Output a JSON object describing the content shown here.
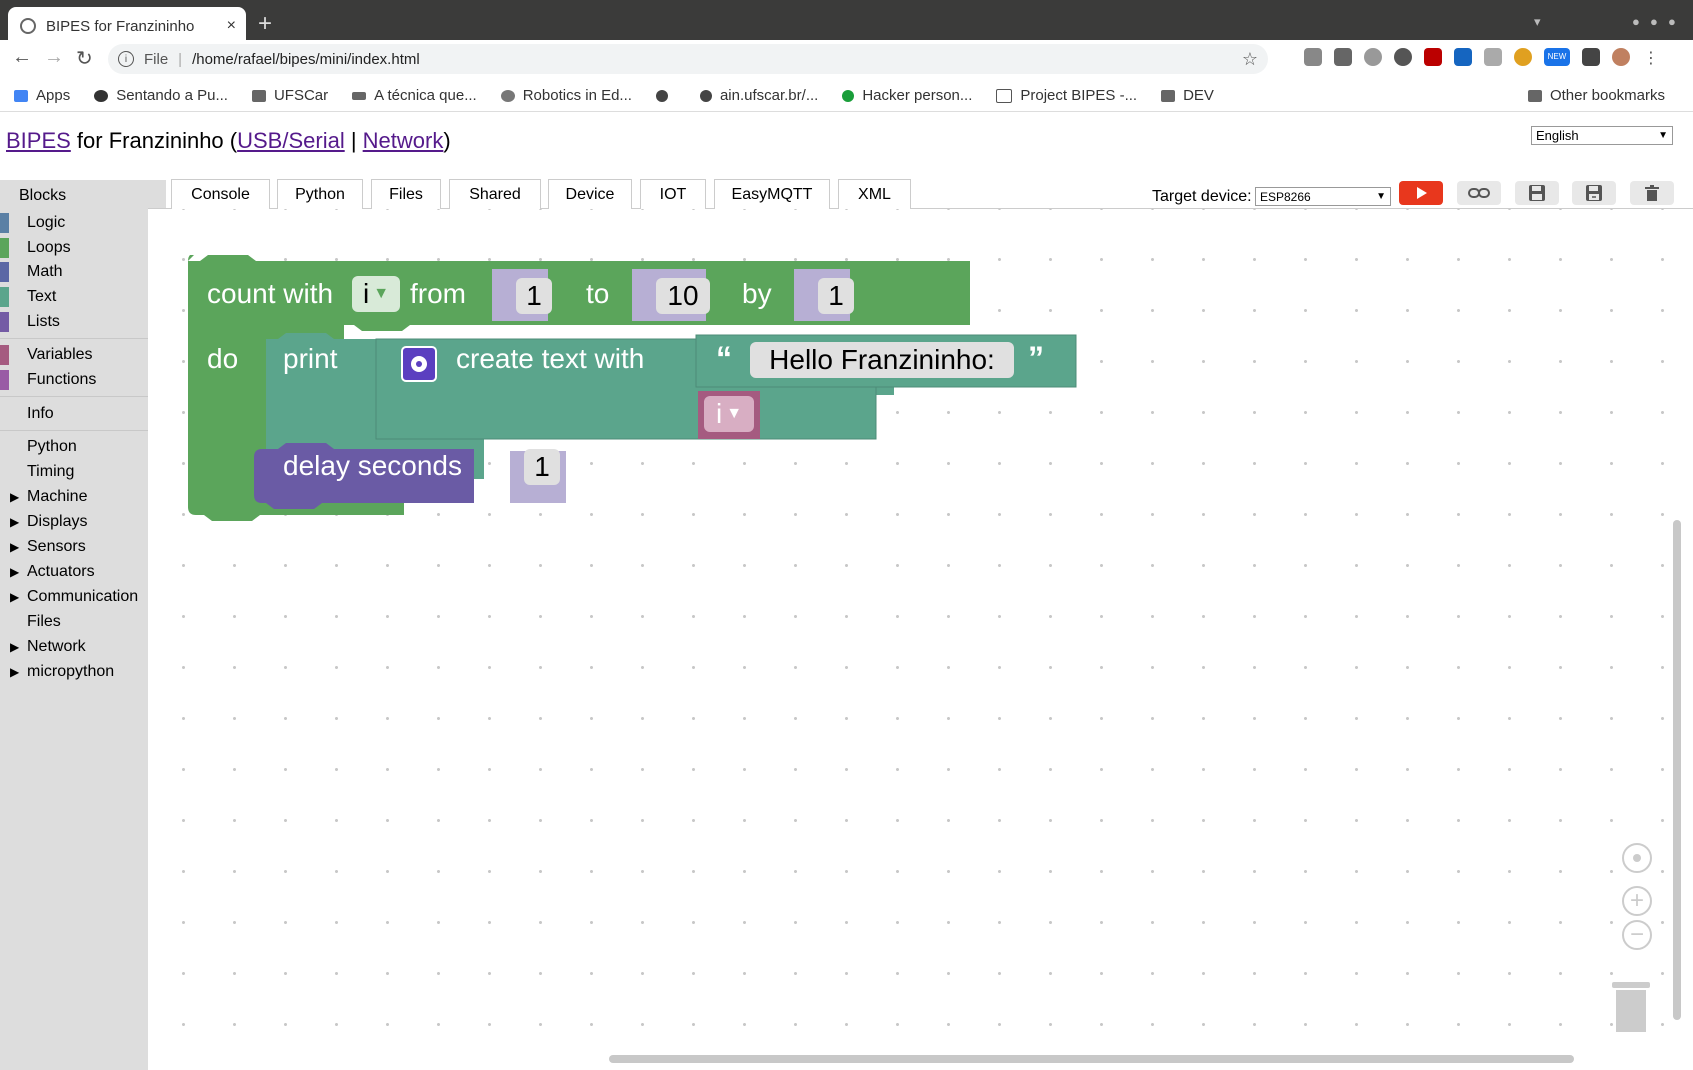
{
  "browser": {
    "tab_title": "BIPES for Franzininho",
    "tab_close": "×",
    "new_tab": "+",
    "url_scheme": "File",
    "url_sep": "|",
    "url": "/home/rafael/bipes/mini/index.html",
    "bookmarks": [
      {
        "label": "Apps"
      },
      {
        "label": "Sentando a Pu..."
      },
      {
        "label": "UFSCar"
      },
      {
        "label": "A técnica que..."
      },
      {
        "label": "Robotics in Ed..."
      },
      {
        "label": ""
      },
      {
        "label": "ain.ufscar.br/..."
      },
      {
        "label": "Hacker person..."
      },
      {
        "label": "Project BIPES -..."
      },
      {
        "label": "DEV"
      }
    ],
    "other_bookmarks": "Other bookmarks",
    "ext_badge": "NEW"
  },
  "page": {
    "title_link1": "BIPES",
    "title_mid": " for Franzininho (",
    "title_link2": "USB/Serial",
    "title_sep": " | ",
    "title_link3": "Network",
    "title_end": ")",
    "language": "English"
  },
  "sidebar": {
    "header": "Blocks",
    "categories": [
      {
        "label": "Logic",
        "color": "#5b80a5"
      },
      {
        "label": "Loops",
        "color": "#5ba55b"
      },
      {
        "label": "Math",
        "color": "#5b67a5"
      },
      {
        "label": "Text",
        "color": "#5ba58c"
      },
      {
        "label": "Lists",
        "color": "#745ba5"
      },
      {
        "label": "Variables",
        "color": "#a55b80"
      },
      {
        "label": "Functions",
        "color": "#995ba5"
      },
      {
        "label": "Info"
      },
      {
        "label": "Python"
      },
      {
        "label": "Timing"
      },
      {
        "label": "Machine"
      },
      {
        "label": "Displays"
      },
      {
        "label": "Sensors"
      },
      {
        "label": "Actuators"
      },
      {
        "label": "Communication"
      },
      {
        "label": "Files"
      },
      {
        "label": "Network"
      },
      {
        "label": "micropython"
      }
    ]
  },
  "tabs": [
    "Console",
    "Python",
    "Files",
    "Shared",
    "Device",
    "IOT",
    "EasyMQTT",
    "XML"
  ],
  "target": {
    "label": "Target device:",
    "value": "ESP8266"
  },
  "program": {
    "count_with": "count with",
    "var": "i",
    "from": "from",
    "from_val": "1",
    "to": "to",
    "to_val": "10",
    "by": "by",
    "by_val": "1",
    "do": "do",
    "print": "print",
    "create_text": "create text with",
    "text_value": "Hello Franzininho:",
    "var2": "i",
    "delay": "delay seconds",
    "delay_val": "1"
  },
  "colors": {
    "loop": "#5ba55b",
    "text": "#5ba58c",
    "variable": "#a55b80",
    "timing": "#6a5ba5",
    "run": "#e8371d"
  }
}
